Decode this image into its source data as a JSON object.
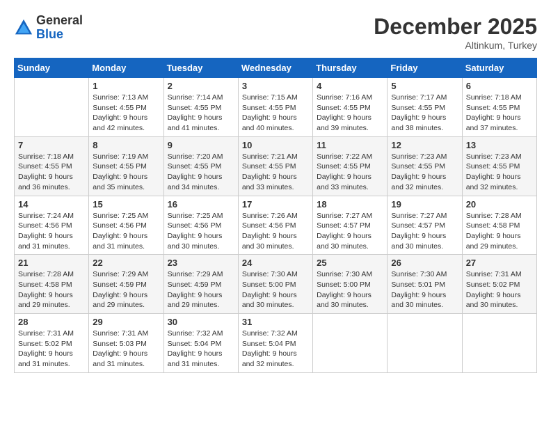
{
  "header": {
    "logo": {
      "line1": "General",
      "line2": "Blue"
    },
    "title": "December 2025",
    "subtitle": "Altinkum, Turkey"
  },
  "columns": [
    "Sunday",
    "Monday",
    "Tuesday",
    "Wednesday",
    "Thursday",
    "Friday",
    "Saturday"
  ],
  "weeks": [
    [
      {
        "day": "",
        "info": ""
      },
      {
        "day": "1",
        "info": "Sunrise: 7:13 AM\nSunset: 4:55 PM\nDaylight: 9 hours\nand 42 minutes."
      },
      {
        "day": "2",
        "info": "Sunrise: 7:14 AM\nSunset: 4:55 PM\nDaylight: 9 hours\nand 41 minutes."
      },
      {
        "day": "3",
        "info": "Sunrise: 7:15 AM\nSunset: 4:55 PM\nDaylight: 9 hours\nand 40 minutes."
      },
      {
        "day": "4",
        "info": "Sunrise: 7:16 AM\nSunset: 4:55 PM\nDaylight: 9 hours\nand 39 minutes."
      },
      {
        "day": "5",
        "info": "Sunrise: 7:17 AM\nSunset: 4:55 PM\nDaylight: 9 hours\nand 38 minutes."
      },
      {
        "day": "6",
        "info": "Sunrise: 7:18 AM\nSunset: 4:55 PM\nDaylight: 9 hours\nand 37 minutes."
      }
    ],
    [
      {
        "day": "7",
        "info": "Sunrise: 7:18 AM\nSunset: 4:55 PM\nDaylight: 9 hours\nand 36 minutes."
      },
      {
        "day": "8",
        "info": "Sunrise: 7:19 AM\nSunset: 4:55 PM\nDaylight: 9 hours\nand 35 minutes."
      },
      {
        "day": "9",
        "info": "Sunrise: 7:20 AM\nSunset: 4:55 PM\nDaylight: 9 hours\nand 34 minutes."
      },
      {
        "day": "10",
        "info": "Sunrise: 7:21 AM\nSunset: 4:55 PM\nDaylight: 9 hours\nand 33 minutes."
      },
      {
        "day": "11",
        "info": "Sunrise: 7:22 AM\nSunset: 4:55 PM\nDaylight: 9 hours\nand 33 minutes."
      },
      {
        "day": "12",
        "info": "Sunrise: 7:23 AM\nSunset: 4:55 PM\nDaylight: 9 hours\nand 32 minutes."
      },
      {
        "day": "13",
        "info": "Sunrise: 7:23 AM\nSunset: 4:55 PM\nDaylight: 9 hours\nand 32 minutes."
      }
    ],
    [
      {
        "day": "14",
        "info": "Sunrise: 7:24 AM\nSunset: 4:56 PM\nDaylight: 9 hours\nand 31 minutes."
      },
      {
        "day": "15",
        "info": "Sunrise: 7:25 AM\nSunset: 4:56 PM\nDaylight: 9 hours\nand 31 minutes."
      },
      {
        "day": "16",
        "info": "Sunrise: 7:25 AM\nSunset: 4:56 PM\nDaylight: 9 hours\nand 30 minutes."
      },
      {
        "day": "17",
        "info": "Sunrise: 7:26 AM\nSunset: 4:56 PM\nDaylight: 9 hours\nand 30 minutes."
      },
      {
        "day": "18",
        "info": "Sunrise: 7:27 AM\nSunset: 4:57 PM\nDaylight: 9 hours\nand 30 minutes."
      },
      {
        "day": "19",
        "info": "Sunrise: 7:27 AM\nSunset: 4:57 PM\nDaylight: 9 hours\nand 30 minutes."
      },
      {
        "day": "20",
        "info": "Sunrise: 7:28 AM\nSunset: 4:58 PM\nDaylight: 9 hours\nand 29 minutes."
      }
    ],
    [
      {
        "day": "21",
        "info": "Sunrise: 7:28 AM\nSunset: 4:58 PM\nDaylight: 9 hours\nand 29 minutes."
      },
      {
        "day": "22",
        "info": "Sunrise: 7:29 AM\nSunset: 4:59 PM\nDaylight: 9 hours\nand 29 minutes."
      },
      {
        "day": "23",
        "info": "Sunrise: 7:29 AM\nSunset: 4:59 PM\nDaylight: 9 hours\nand 29 minutes."
      },
      {
        "day": "24",
        "info": "Sunrise: 7:30 AM\nSunset: 5:00 PM\nDaylight: 9 hours\nand 30 minutes."
      },
      {
        "day": "25",
        "info": "Sunrise: 7:30 AM\nSunset: 5:00 PM\nDaylight: 9 hours\nand 30 minutes."
      },
      {
        "day": "26",
        "info": "Sunrise: 7:30 AM\nSunset: 5:01 PM\nDaylight: 9 hours\nand 30 minutes."
      },
      {
        "day": "27",
        "info": "Sunrise: 7:31 AM\nSunset: 5:02 PM\nDaylight: 9 hours\nand 30 minutes."
      }
    ],
    [
      {
        "day": "28",
        "info": "Sunrise: 7:31 AM\nSunset: 5:02 PM\nDaylight: 9 hours\nand 31 minutes."
      },
      {
        "day": "29",
        "info": "Sunrise: 7:31 AM\nSunset: 5:03 PM\nDaylight: 9 hours\nand 31 minutes."
      },
      {
        "day": "30",
        "info": "Sunrise: 7:32 AM\nSunset: 5:04 PM\nDaylight: 9 hours\nand 31 minutes."
      },
      {
        "day": "31",
        "info": "Sunrise: 7:32 AM\nSunset: 5:04 PM\nDaylight: 9 hours\nand 32 minutes."
      },
      {
        "day": "",
        "info": ""
      },
      {
        "day": "",
        "info": ""
      },
      {
        "day": "",
        "info": ""
      }
    ]
  ]
}
